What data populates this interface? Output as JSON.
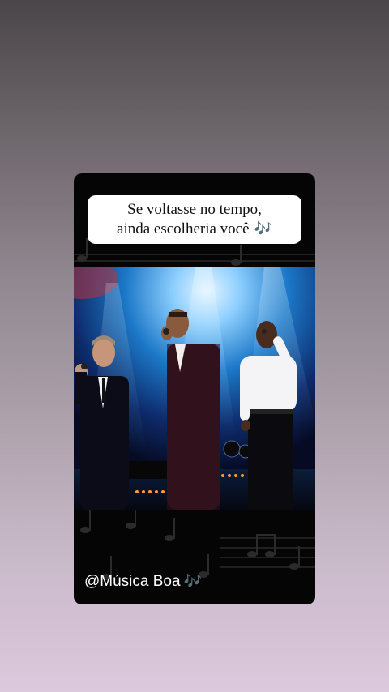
{
  "caption": {
    "line1": "Se voltasse no tempo,",
    "line2": "ainda escolheria você",
    "icon": "music-notes-icon",
    "glyph": "🎶"
  },
  "video": {
    "description_icon": "concert-photo"
  },
  "footer": {
    "handle": "@Música Boa",
    "icon": "music-notes-icon",
    "glyph": "🎶"
  },
  "colors": {
    "card_bg": "#050505",
    "caption_bg": "#ffffff",
    "handle_text": "#ffffff",
    "note_accent": "#c77be0"
  }
}
